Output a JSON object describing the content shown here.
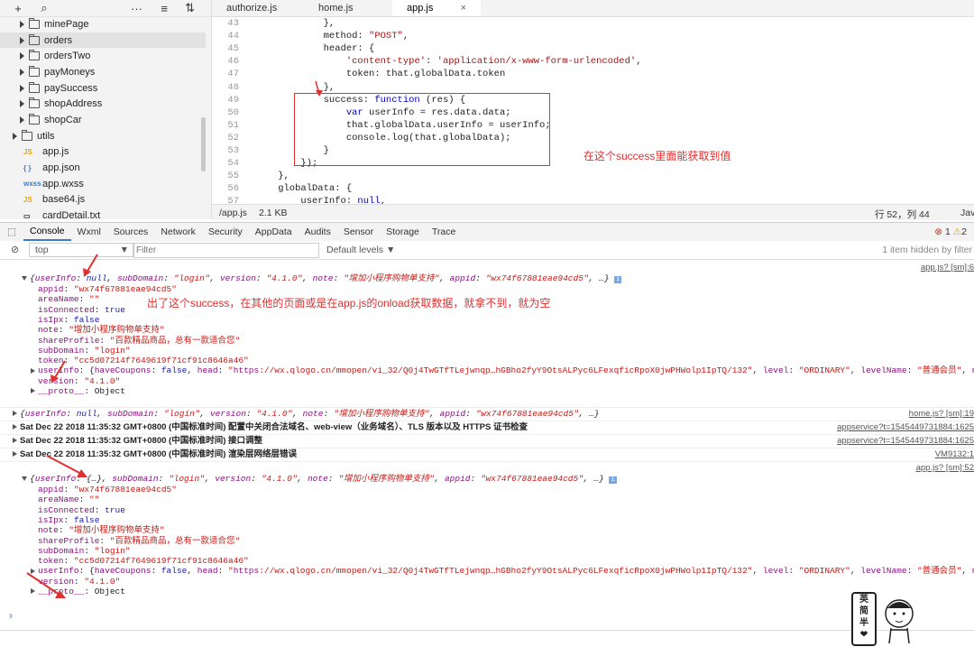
{
  "sidebar": {
    "toolbar": [
      "+",
      "⌕",
      "···",
      "≡",
      "⇅"
    ],
    "tree": [
      {
        "label": "minePage",
        "type": "folder",
        "indent": 1
      },
      {
        "label": "orders",
        "type": "folder",
        "indent": 1,
        "selected": true
      },
      {
        "label": "ordersTwo",
        "type": "folder",
        "indent": 1
      },
      {
        "label": "payMoneys",
        "type": "folder",
        "indent": 1
      },
      {
        "label": "paySuccess",
        "type": "folder",
        "indent": 1
      },
      {
        "label": "shopAddress",
        "type": "folder",
        "indent": 1
      },
      {
        "label": "shopCar",
        "type": "folder",
        "indent": 1
      },
      {
        "label": "utils",
        "type": "folder",
        "indent": 0
      },
      {
        "label": "app.js",
        "type": "js",
        "indent": 0
      },
      {
        "label": "app.json",
        "type": "json",
        "indent": 0
      },
      {
        "label": "app.wxss",
        "type": "wxss",
        "indent": 0
      },
      {
        "label": "base64.js",
        "type": "js",
        "indent": 0
      },
      {
        "label": "cardDetail.txt",
        "type": "txt",
        "indent": 0
      }
    ]
  },
  "editor": {
    "tabs": [
      "authorize.js",
      "home.js",
      "app.js"
    ],
    "close_label": "×",
    "lines": [
      {
        "n": "43",
        "t": "            },"
      },
      {
        "n": "44",
        "t": "            method: \"POST\","
      },
      {
        "n": "45",
        "t": "            header: {"
      },
      {
        "n": "46",
        "t": "                'content-type': 'application/x-www-form-urlencoded',"
      },
      {
        "n": "47",
        "t": "                token: that.globalData.token"
      },
      {
        "n": "48",
        "t": "            },"
      },
      {
        "n": "49",
        "t": "            success: function (res) {"
      },
      {
        "n": "50",
        "t": "                var userInfo = res.data.data;"
      },
      {
        "n": "51",
        "t": "                that.globalData.userInfo = userInfo;"
      },
      {
        "n": "52",
        "t": "                console.log(that.globalData);"
      },
      {
        "n": "53",
        "t": "            }"
      },
      {
        "n": "54",
        "t": "        });"
      },
      {
        "n": "55",
        "t": "    },"
      },
      {
        "n": "56",
        "t": "    globalData: {"
      },
      {
        "n": "57",
        "t": "        userInfo: null,"
      }
    ],
    "status": {
      "file": "/app.js",
      "size": "2.1 KB",
      "pos": "行 52，列 44",
      "lang": "Jav"
    }
  },
  "annotations": {
    "code_note": "在这个success里面能获取到值",
    "console_note": "出了这个success，在其他的页面或是在app.js的onload获取数据，就拿不到，就为空"
  },
  "devtools": {
    "tabs": [
      "Console",
      "Wxml",
      "Sources",
      "Network",
      "Security",
      "AppData",
      "Audits",
      "Sensor",
      "Storage",
      "Trace"
    ],
    "errors": "1",
    "warnings": "2",
    "context": "top",
    "filter_placeholder": "Filter",
    "levels": "Default levels ▼",
    "hidden": "1 item hidden by filter"
  },
  "console": {
    "obj1_header": "{userInfo: null, subDomain: \"login\", version: \"4.1.0\", note: \"增加小程序购物单支持\", appid: \"wx74f67881eae94cd5\", …}",
    "obj1_src": "app.js? [sm]:6",
    "props": [
      {
        "k": "appid",
        "v": "\"wx74f67881eae94cd5\"",
        "t": "s"
      },
      {
        "k": "areaName",
        "v": "\"\"",
        "t": "s"
      },
      {
        "k": "isConnected",
        "v": "true",
        "t": "v"
      },
      {
        "k": "isIpx",
        "v": "false",
        "t": "v"
      },
      {
        "k": "note",
        "v": "\"增加小程序购物单支持\"",
        "t": "s"
      },
      {
        "k": "shareProfile",
        "v": "\"百款精品商品，总有一款适合您\"",
        "t": "s"
      },
      {
        "k": "subDomain",
        "v": "\"login\"",
        "t": "s"
      },
      {
        "k": "token",
        "v": "\"cc5d07214f7649619f71cf91c8646a46\"",
        "t": "s"
      }
    ],
    "userinfo_line": "userInfo: {haveCoupons: false, head: \"https://wx.qlogo.cn/mmopen/vi_32/Q0j4TwGTfTLejwnqp…hGBho2fyY9OtsALPyc6LFexqficRpoX0jwPHWolp1IpTQ/132\", level: \"ORDINARY\", levelName: \"普通会员\", name: \"朱钢芳\", …}",
    "version_line": "version: \"4.1.0\"",
    "proto_line": "__proto__: Object",
    "obj2_header": "{userInfo: null, subDomain: \"login\", version: \"4.1.0\", note: \"增加小程序购物单支持\", appid: \"wx74f67881eae94cd5\", …}",
    "obj2_src": "home.js? [sm]:19",
    "log1": "Sat Dec 22 2018 11:35:32 GMT+0800 (中国标准时间) 配置中关闭合法域名、web-view（业务域名）、TLS 版本以及 HTTPS 证书检查",
    "log1_src": "appservice?t=1545449731884:1625",
    "log2": "Sat Dec 22 2018 11:35:32 GMT+0800 (中国标准时间) 接口调整",
    "log2_src": "appservice?t=1545449731884:1625",
    "log3": "Sat Dec 22 2018 11:35:32 GMT+0800 (中国标准时间) 渲染层网络层错误",
    "log3_src": "VM9132:1",
    "obj3_src": "app.js? [sm]:52",
    "obj3_header": "{userInfo: {…}, subDomain: \"login\", version: \"4.1.0\", note: \"增加小程序购物单支持\", appid: \"wx74f67881eae94cd5\", …}",
    "prompt": "›"
  },
  "watermark": {
    "text": "英\n简\n半\n❤"
  }
}
